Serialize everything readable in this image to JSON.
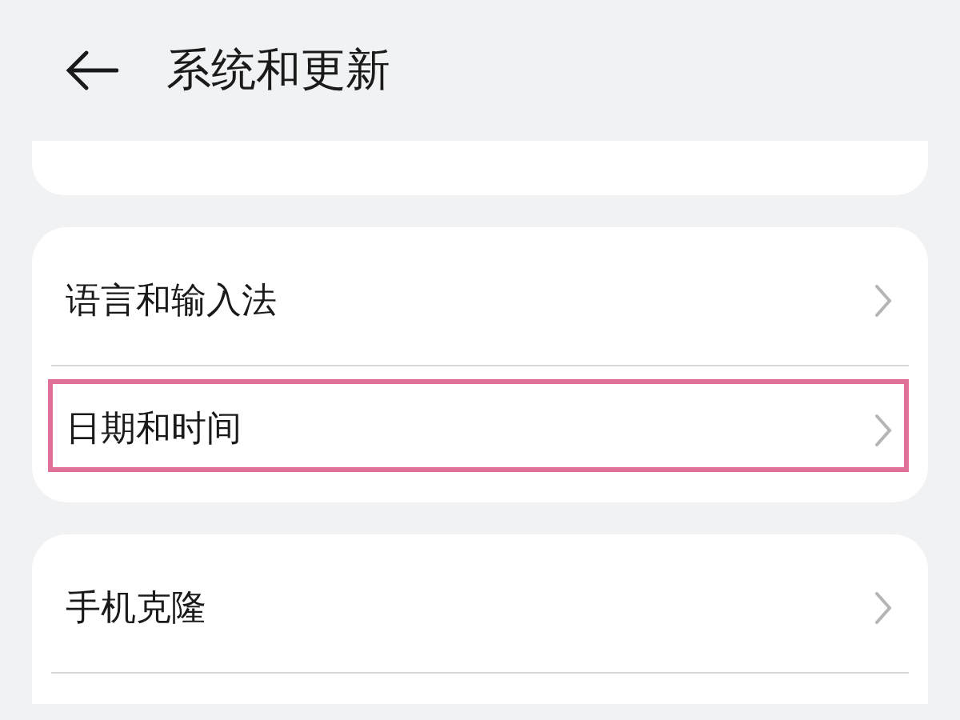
{
  "header": {
    "title": "系统和更新"
  },
  "groups": [
    {
      "items": [
        {
          "label": "语言和输入法",
          "highlighted": false
        },
        {
          "label": "日期和时间",
          "highlighted": true
        }
      ]
    },
    {
      "items": [
        {
          "label": "手机克隆",
          "highlighted": false
        }
      ]
    }
  ]
}
